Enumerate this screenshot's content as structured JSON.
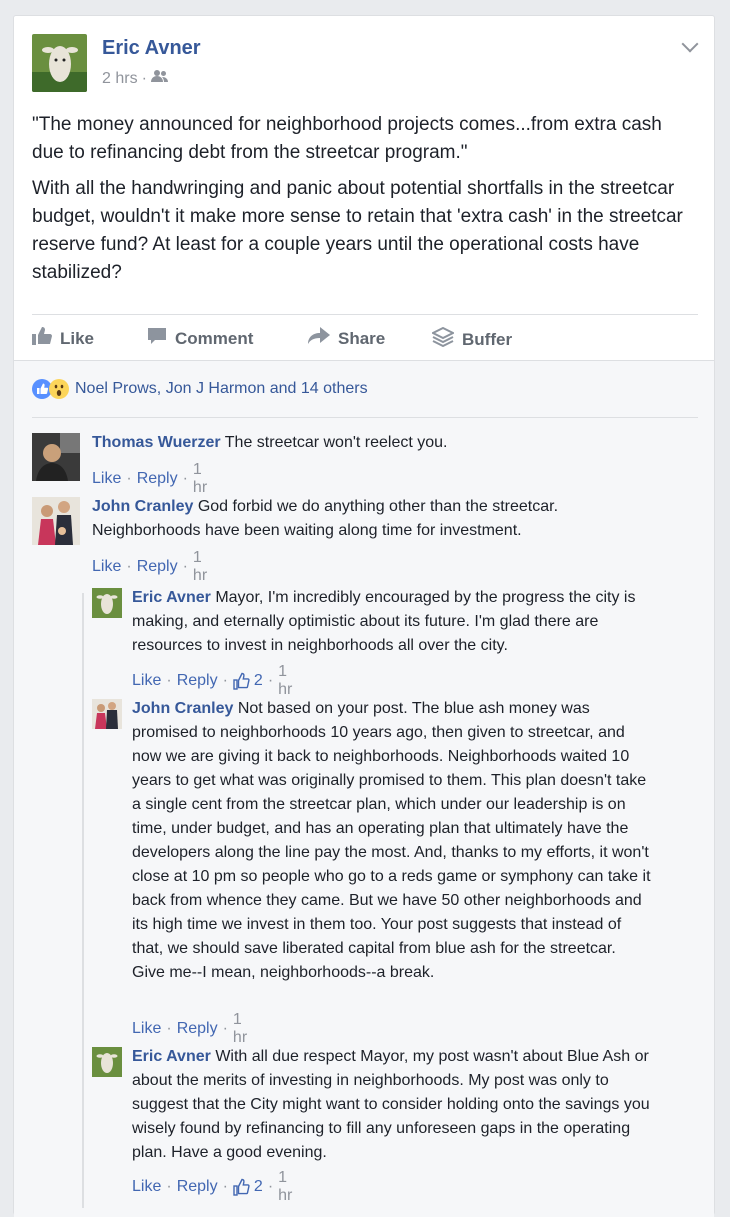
{
  "post": {
    "author": "Eric Avner",
    "time": "2 hrs",
    "paragraph1": "\"The money announced for neighborhood projects comes...from extra cash due to refinancing debt from the streetcar program.\"",
    "paragraph2": "With all the handwringing and panic about potential shortfalls in the streetcar budget, wouldn't it make more sense to retain that 'extra cash' in the streetcar reserve fund? At least for a couple years until the operational costs have stabilized?"
  },
  "actions": {
    "like": "Like",
    "comment": "Comment",
    "share": "Share",
    "buffer": "Buffer"
  },
  "reactions": {
    "summary": "Noel Prows, Jon J Harmon and 14 others"
  },
  "comments": [
    {
      "name": "Thomas Wuerzer",
      "text": "The streetcar won't reelect you.",
      "like": "Like",
      "reply": "Reply",
      "time": "1 hr"
    },
    {
      "name": "John Cranley",
      "text": "God forbid we do anything other than the streetcar. Neighborhoods have been waiting along time for investment.",
      "like": "Like",
      "reply": "Reply",
      "time": "1 hr"
    }
  ],
  "replies": [
    {
      "name": "Eric Avner",
      "text": "Mayor, I'm incredibly encouraged by the progress the city is making, and eternally optimistic about its future. I'm glad there are resources to invest in neighborhoods all over the city.",
      "like": "Like",
      "reply": "Reply",
      "likes_count": "2",
      "time": "1 hr"
    },
    {
      "name": "John Cranley",
      "text": "Not based on your post. The blue ash money was promised to neighborhoods 10 years ago, then given to streetcar, and now we are giving it back to neighborhoods. Neighborhoods waited 10 years to get what was originally promised to them. This plan doesn't take a single cent from the streetcar plan, which under our leadership is on time, under budget, and has an operating plan that ultimately have the developers along the line pay the most. And, thanks to my efforts, it won't close at 10 pm so people who go to a reds game or symphony can take it back from whence they came. But we have 50 other neighborhoods and its high time we invest in them too. Your post suggests that instead of that, we should save liberated capital from blue ash for the streetcar. Give me--I mean, neighborhoods--a break.",
      "like": "Like",
      "reply": "Reply",
      "time": "1 hr"
    },
    {
      "name": "Eric Avner",
      "text": "With all due respect Mayor, my post wasn't about Blue Ash or about the merits of investing in neighborhoods. My post was only to suggest that the City might want to consider holding onto the savings you wisely found by refinancing to fill any unforeseen gaps in the operating plan. Have a good evening.",
      "like": "Like",
      "reply": "Reply",
      "likes_count": "2",
      "time": "1 hr"
    }
  ],
  "separator": "·",
  "colors": {
    "link": "#365899",
    "meta": "#90949c",
    "action": "#606770",
    "like_blue": "#4267b2",
    "background": "#e9ebee"
  },
  "icons": {
    "audience": "friends-icon",
    "menu": "chevron-down-icon",
    "like": "thumbs-up-icon",
    "comment": "speech-bubble-icon",
    "share": "arrow-icon",
    "buffer": "stack-icon",
    "reaction_like": "like-reaction-icon",
    "reaction_wow": "wow-reaction-icon"
  }
}
